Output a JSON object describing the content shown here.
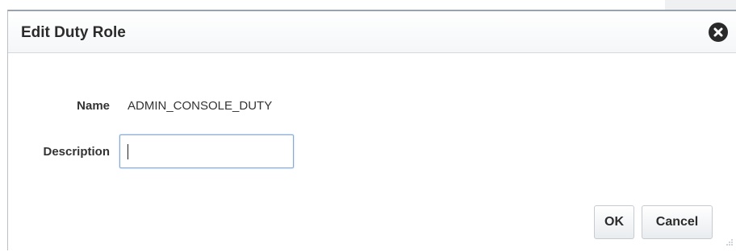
{
  "dialog": {
    "title": "Edit Duty Role",
    "close_icon": "close-circle-icon"
  },
  "form": {
    "name_label": "Name",
    "name_value": "ADMIN_CONSOLE_DUTY",
    "description_label": "Description",
    "description_value": "",
    "description_placeholder": ""
  },
  "buttons": {
    "ok_label": "OK",
    "cancel_label": "Cancel"
  },
  "colors": {
    "input_focus_border": "#86a8d6",
    "close_button_bg": "#2a2a2a"
  }
}
